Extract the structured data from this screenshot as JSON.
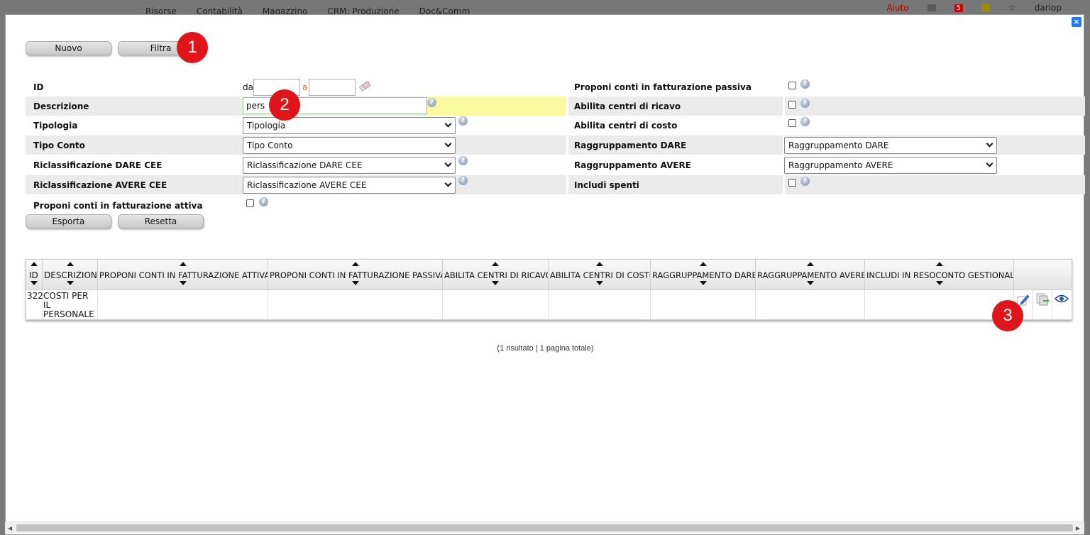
{
  "background_app": {
    "menu": [
      "Risorse",
      "Contabilità",
      "Magazzino",
      "CRM: Produzione",
      "Doc&Comm"
    ],
    "aiuto": "Aiuto",
    "notif_count": "5",
    "user": "dariop"
  },
  "modal": {
    "close_label": "×",
    "buttons": {
      "nuovo": "Nuovo",
      "filtra": "Filtra",
      "esporta": "Esporta",
      "resetta": "Resetta"
    },
    "markers": [
      "1",
      "2",
      "3"
    ],
    "filters": {
      "id": {
        "label": "ID",
        "da_label": "da",
        "a_label": "a",
        "da_value": "",
        "a_value": ""
      },
      "descrizione": {
        "label": "Descrizione",
        "value": "pers"
      },
      "tipologia": {
        "label": "Tipologia",
        "selected": "Tipologia"
      },
      "tipo_conto": {
        "label": "Tipo Conto",
        "selected": "Tipo Conto"
      },
      "ricl_dare": {
        "label": "Riclassificazione DARE CEE",
        "selected": "Riclassificazione DARE CEE"
      },
      "ricl_avere": {
        "label": "Riclassificazione AVERE CEE",
        "selected": "Riclassificazione AVERE CEE"
      },
      "proponi_attiva": {
        "label": "Proponi conti in fatturazione attiva",
        "checked": false
      },
      "proponi_passiva": {
        "label": "Proponi conti in fatturazione passiva",
        "checked": false
      },
      "centri_ricavo": {
        "label": "Abilita centri di ricavo",
        "checked": false
      },
      "centri_costo": {
        "label": "Abilita centri di costo",
        "checked": false
      },
      "ragg_dare": {
        "label": "Raggruppamento DARE",
        "selected": "Raggruppamento DARE"
      },
      "ragg_avere": {
        "label": "Raggruppamento AVERE",
        "selected": "Raggruppamento AVERE"
      },
      "includi_spenti": {
        "label": "Includi spenti",
        "checked": false
      },
      "help_glyph": "?"
    },
    "table": {
      "columns": [
        "ID",
        "DESCRIZIONE",
        "PROPONI CONTI IN FATTURAZIONE ATTIVA",
        "PROPONI CONTI IN FATTURAZIONE PASSIVA",
        "ABILITA CENTRI DI RICAVO",
        "ABILITA CENTRI DI COSTO",
        "RAGGRUPPAMENTO DARE",
        "RAGGRUPPAMENTO AVERE",
        "INCLUDI IN RESOCONTO GESTIONALE"
      ],
      "rows": [
        {
          "id": "322",
          "descrizione": "COSTI PER IL PERSONALE",
          "actions": [
            "edit-icon",
            "duplicate-icon",
            "view-icon"
          ]
        }
      ]
    },
    "pager": "(1 risultato | 1 pagina totale)"
  },
  "colors": {
    "marker": "#e0141b",
    "highlight": "#fafaa0",
    "close": "#1e78ff"
  }
}
